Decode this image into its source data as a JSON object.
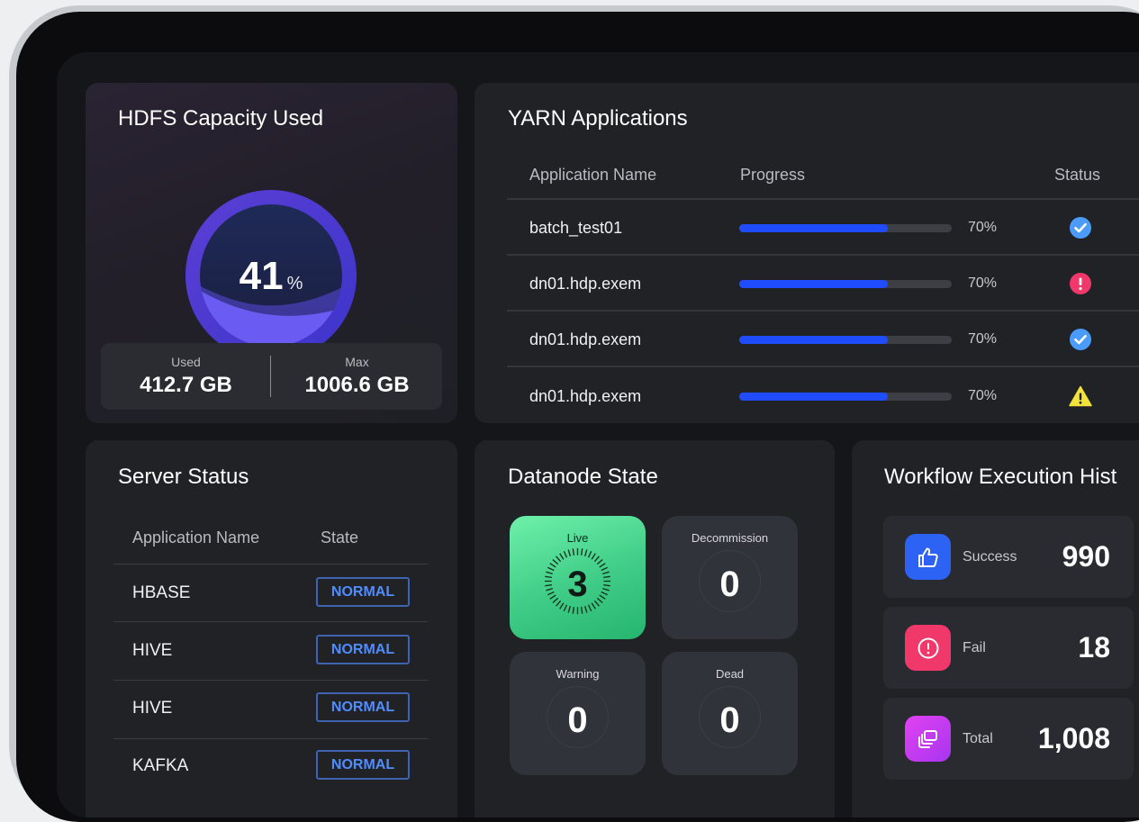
{
  "hdfs": {
    "title": "HDFS Capacity Used",
    "percent": "41",
    "percent_unit": "%",
    "used_label": "Used",
    "used_value": "412.7 GB",
    "max_label": "Max",
    "max_value": "1006.6 GB"
  },
  "yarn": {
    "title": "YARN Applications",
    "headers": {
      "name": "Application Name",
      "progress": "Progress",
      "status": "Status"
    },
    "rows": [
      {
        "name": "batch_test01",
        "progress": 0.7,
        "progress_label": "70%",
        "status": "success"
      },
      {
        "name": "dn01.hdp.exem",
        "progress": 0.7,
        "progress_label": "70%",
        "status": "error"
      },
      {
        "name": "dn01.hdp.exem",
        "progress": 0.7,
        "progress_label": "70%",
        "status": "success"
      },
      {
        "name": "dn01.hdp.exem",
        "progress": 0.7,
        "progress_label": "70%",
        "status": "warning"
      }
    ]
  },
  "server": {
    "title": "Server Status",
    "headers": {
      "name": "Application Name",
      "state": "State"
    },
    "rows": [
      {
        "name": "HBASE",
        "state": "NORMAL"
      },
      {
        "name": "HIVE",
        "state": "NORMAL"
      },
      {
        "name": "HIVE",
        "state": "NORMAL"
      },
      {
        "name": "KAFKA",
        "state": "NORMAL"
      }
    ]
  },
  "datanode": {
    "title": "Datanode State",
    "live_label": "Live",
    "live_value": "3",
    "decommission_label": "Decommission",
    "decommission_value": "0",
    "warning_label": "Warning",
    "warning_value": "0",
    "dead_label": "Dead",
    "dead_value": "0"
  },
  "workflow": {
    "title": "Workflow Execution Hist",
    "success_label": "Success",
    "success_value": "990",
    "fail_label": "Fail",
    "fail_value": "18",
    "total_label": "Total",
    "total_value": "1,008"
  },
  "colors": {
    "accent_blue": "#1f4cff",
    "status_success": "#4b9bff",
    "status_error": "#f0386b",
    "status_warning": "#f2e33c",
    "live_green": "#3fcc86",
    "success_icon_bg": "#2d63f5",
    "fail_icon_bg": "#f0386b",
    "total_icon_bg": "#c43cf0"
  },
  "icons": {
    "success": "check-circle-icon",
    "error": "exclamation-circle-icon",
    "warning": "warning-triangle-icon",
    "workflow_success": "thumbs-up-icon",
    "workflow_fail": "alert-circle-icon",
    "workflow_total": "stack-icon"
  }
}
